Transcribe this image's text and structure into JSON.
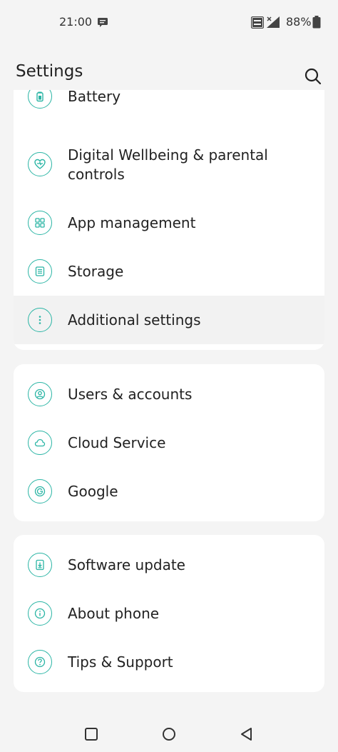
{
  "status_bar": {
    "time": "21:00",
    "battery_percent": "88%",
    "icons": [
      "message-notification-icon",
      "volte-icon",
      "signal-icon",
      "battery-icon"
    ]
  },
  "header": {
    "title": "Settings",
    "search_icon": "search-icon"
  },
  "groups": [
    {
      "items": [
        {
          "label": "Battery",
          "icon": "battery-icon"
        },
        {
          "label": "Digital Wellbeing & parental",
          "label_line2": "controls",
          "icon": "heart-icon"
        },
        {
          "label": "App management",
          "icon": "grid-icon"
        },
        {
          "label": "Storage",
          "icon": "storage-icon"
        },
        {
          "label": "Additional settings",
          "icon": "more-vertical-icon"
        }
      ]
    },
    {
      "items": [
        {
          "label": "Users & accounts",
          "icon": "user-icon"
        },
        {
          "label": "Cloud Service",
          "icon": "cloud-icon"
        },
        {
          "label": "Google",
          "icon": "google-icon"
        }
      ]
    },
    {
      "items": [
        {
          "label": "Software update",
          "icon": "download-icon"
        },
        {
          "label": "About phone",
          "icon": "info-icon"
        },
        {
          "label": "Tips & Support",
          "icon": "help-icon"
        }
      ]
    }
  ],
  "nav_bar": {
    "icons": [
      "recents-icon",
      "home-icon",
      "back-icon"
    ]
  },
  "colors": {
    "accent": "#2bb5a5",
    "background": "#f4f4f4",
    "card": "#ffffff"
  }
}
